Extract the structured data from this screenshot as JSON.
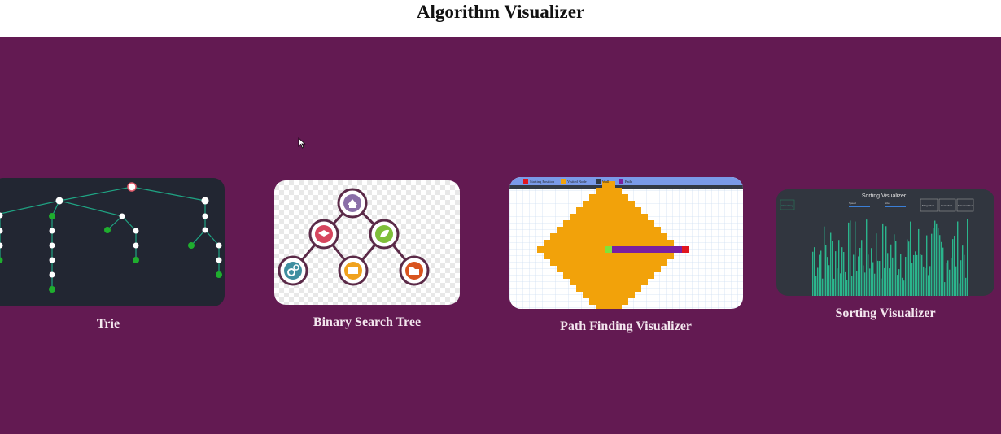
{
  "app": {
    "title": "Algorithm Visualizer"
  },
  "cards": [
    {
      "label": "Trie"
    },
    {
      "label": "Binary Search Tree"
    },
    {
      "label": "Path Finding Visualizer",
      "legend": [
        "Starting Position",
        "Visited Node",
        "Wall",
        "Path"
      ]
    },
    {
      "label": "Sorting Visualizer",
      "screen_title": "Sorting Visualizer",
      "slider_labels": [
        "Speed",
        "Size"
      ],
      "buttons": [
        "Merge Sort",
        "Quick Sort",
        "Selection Sort"
      ],
      "left_button": "New Array"
    }
  ],
  "colors": {
    "background": "#631a52",
    "trie_bg": "#222632",
    "grid_visited": "#f2a20a",
    "path": "#7a1fa0",
    "start": "#e1161f",
    "sort_bar": "#2bb58c"
  }
}
